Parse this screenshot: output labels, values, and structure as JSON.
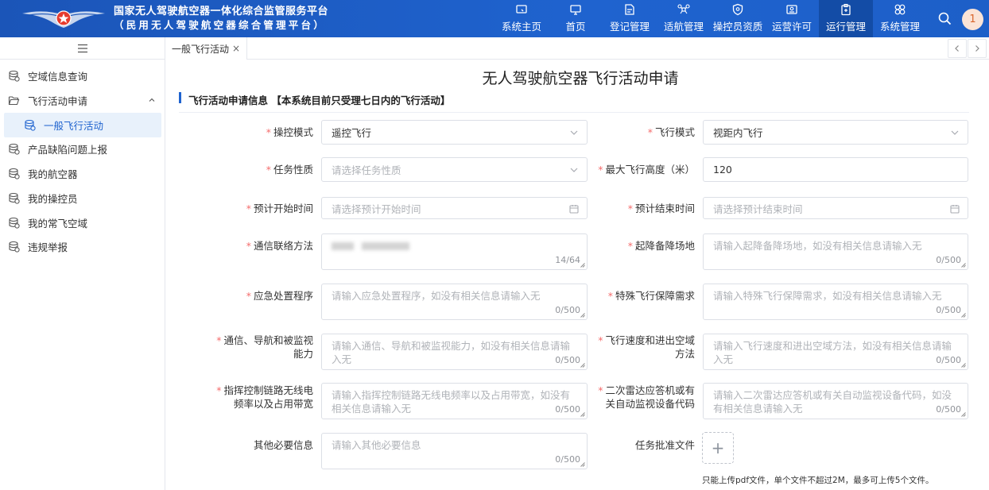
{
  "header": {
    "title_line1": "国家无人驾驶航空器一体化综合监管服务平台",
    "title_line2": "（民用无人驾驶航空器综合管理平台）",
    "nav": [
      {
        "label": "系统主页",
        "icon": "monitor-icon"
      },
      {
        "label": "首页",
        "icon": "desktop-icon"
      },
      {
        "label": "登记管理",
        "icon": "register-icon"
      },
      {
        "label": "适航管理",
        "icon": "drone-icon"
      },
      {
        "label": "操控员资质",
        "icon": "shield-icon"
      },
      {
        "label": "运营许可",
        "icon": "license-icon"
      },
      {
        "label": "运行管理",
        "icon": "clipboard-icon",
        "active": true
      },
      {
        "label": "系统管理",
        "icon": "settings-icon"
      }
    ],
    "avatar_text": "1",
    "accent": "#1f63cf"
  },
  "sidebar": {
    "items": [
      {
        "label": "空域信息查询",
        "icon": "db-icon"
      },
      {
        "label": "飞行活动申请",
        "icon": "folder-open-icon",
        "expanded": true
      },
      {
        "label": "一般飞行活动",
        "icon": "db-icon",
        "sub": true,
        "active": true
      },
      {
        "label": "产品缺陷问题上报",
        "icon": "db-icon"
      },
      {
        "label": "我的航空器",
        "icon": "db-icon"
      },
      {
        "label": "我的操控员",
        "icon": "db-icon"
      },
      {
        "label": "我的常飞空域",
        "icon": "db-icon"
      },
      {
        "label": "违规举报",
        "icon": "db-icon"
      }
    ]
  },
  "tabs": [
    {
      "label": "一般飞行活动",
      "close": "×"
    }
  ],
  "page": {
    "title": "无人驾驶航空器飞行活动申请",
    "section_title": "飞行活动申请信息 【本系统目前只受理七日内的飞行活动】"
  },
  "form": {
    "control_mode": {
      "label": "操控模式",
      "value": "遥控飞行"
    },
    "flight_mode": {
      "label": "飞行模式",
      "value": "视距内飞行"
    },
    "task_nature": {
      "label": "任务性质",
      "placeholder": "请选择任务性质"
    },
    "max_altitude": {
      "label": "最大飞行高度（米）",
      "value": "120"
    },
    "start_time": {
      "label": "预计开始时间",
      "placeholder": "请选择预计开始时间"
    },
    "end_time": {
      "label": "预计结束时间",
      "placeholder": "请选择预计结束时间"
    },
    "contact": {
      "label": "通信联络方法",
      "count": "14/64"
    },
    "alt_site": {
      "label": "起降备降场地",
      "placeholder": "请输入起降备降场地，如没有相关信息请输入无",
      "count": "0/500"
    },
    "emergency": {
      "label": "应急处置程序",
      "placeholder": "请输入应急处置程序，如没有相关信息请输入无",
      "count": "0/500"
    },
    "special": {
      "label": "特殊飞行保障需求",
      "placeholder": "请输入特殊飞行保障需求，如没有相关信息请输入无",
      "count": "0/500"
    },
    "cns": {
      "label_1": "通信、导航和被监视",
      "label_2": "能力",
      "placeholder": "请输入通信、导航和被监视能力，如没有相关信息请输入无",
      "count": "0/500"
    },
    "speed": {
      "label_1": "飞行速度和进出空域",
      "label_2": "方法",
      "placeholder": "请输入飞行速度和进出空域方法，如没有相关信息请输入无",
      "count": "0/500"
    },
    "c2link": {
      "label_1": "指挥控制链路无线电",
      "label_2": "频率以及占用带宽",
      "placeholder": "请输入指挥控制链路无线电频率以及占用带宽，如没有相关信息请输入无",
      "count": "0/500"
    },
    "ssr": {
      "label_1": "二次雷达应答机或有",
      "label_2": "关自动监视设备代码",
      "placeholder": "请输入二次雷达应答机或有关自动监视设备代码，如没有相关信息请输入无",
      "count": "0/500"
    },
    "other": {
      "label": "其他必要信息",
      "placeholder": "请输入其他必要信息",
      "count": "0/500"
    },
    "approval": {
      "label": "任务批准文件",
      "upload_symbol": "+",
      "tip": "只能上传pdf文件，单个文件不超过2M，最多可上传5个文件。"
    },
    "required_mark": "*"
  }
}
